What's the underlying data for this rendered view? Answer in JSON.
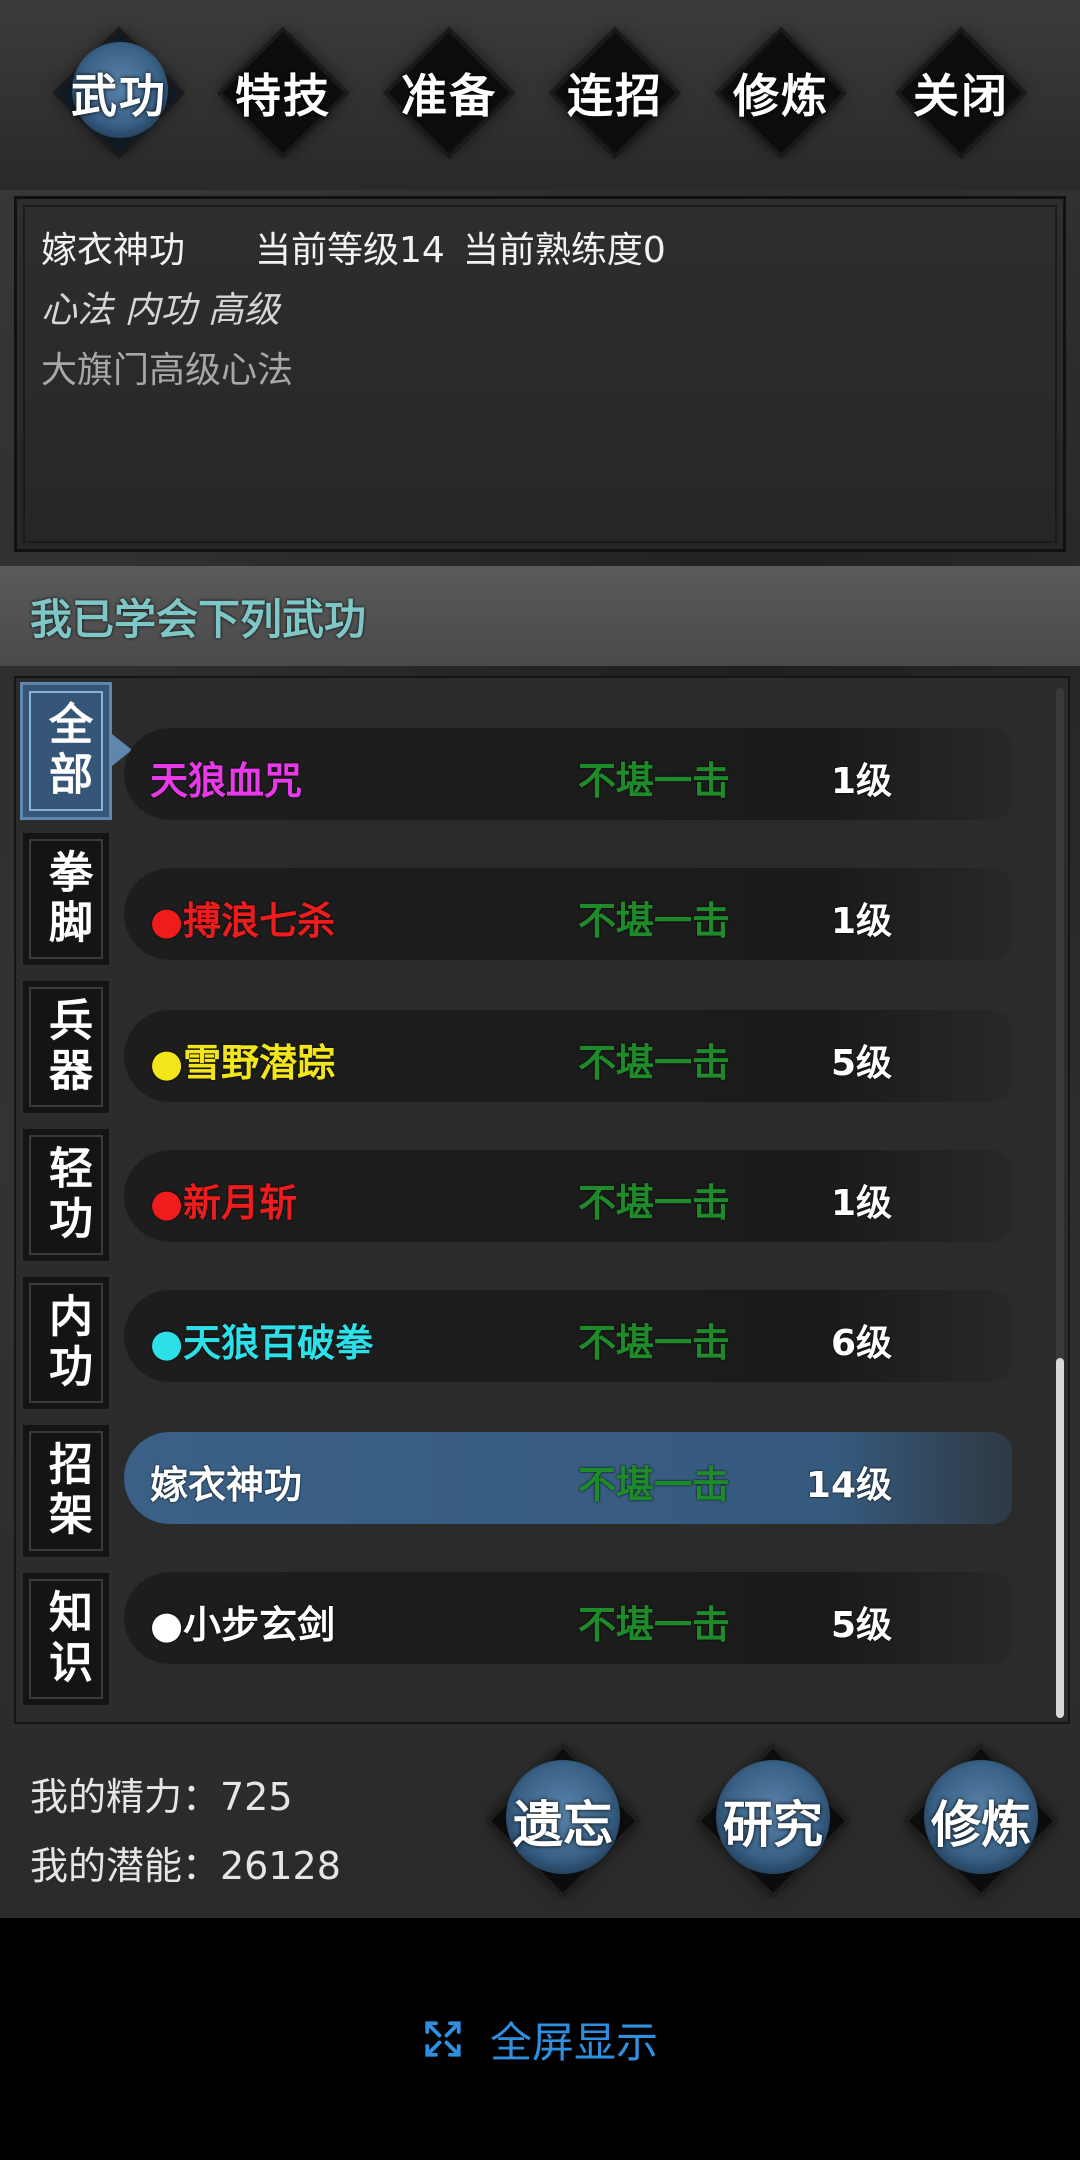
{
  "nav": {
    "tabs": [
      {
        "label": "武功",
        "active": true
      },
      {
        "label": "特技"
      },
      {
        "label": "准备"
      },
      {
        "label": "连招"
      },
      {
        "label": "修炼"
      },
      {
        "label": "关闭"
      }
    ]
  },
  "detail": {
    "name": "嫁衣神功",
    "current_level": "当前等级14",
    "proficiency": "当前熟练度0",
    "type": "心法 内功 高级",
    "description": "大旗门高级心法"
  },
  "section": {
    "title": "我已学会下列武功"
  },
  "categories": [
    {
      "label": "全部",
      "active": true
    },
    {
      "label": "拳脚"
    },
    {
      "label": "兵器"
    },
    {
      "label": "轻功"
    },
    {
      "label": "内功"
    },
    {
      "label": "招架"
    },
    {
      "label": "知识"
    }
  ],
  "skills": [
    {
      "name": "天狼血咒",
      "rank": "不堪一击",
      "level": "1级",
      "color": "#e83ae8"
    },
    {
      "name": "●搏浪七杀",
      "rank": "不堪一击",
      "level": "1级",
      "color": "#ee1c1c"
    },
    {
      "name": "●雪野潜踪",
      "rank": "不堪一击",
      "level": "5级",
      "color": "#f2e51a"
    },
    {
      "name": "●新月斩",
      "rank": "不堪一击",
      "level": "1级",
      "color": "#ee1c1c"
    },
    {
      "name": "●天狼百破拳",
      "rank": "不堪一击",
      "level": "6级",
      "color": "#2de0e8"
    },
    {
      "name": "嫁衣神功",
      "rank": "不堪一击",
      "level": "14级",
      "color": "#ffffff",
      "selected": true
    },
    {
      "name": "●小步玄剑",
      "rank": "不堪一击",
      "level": "5级",
      "color": "#ffffff"
    }
  ],
  "stats": {
    "energy": "我的精力：725",
    "potential": "我的潜能：26128"
  },
  "actions": {
    "forget": "遗忘",
    "research": "研究",
    "train": "修炼"
  },
  "fullscreen": {
    "label": "全屏显示",
    "accent": "#2f8fe0"
  }
}
